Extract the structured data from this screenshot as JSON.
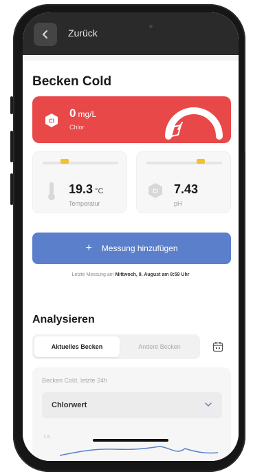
{
  "topbar": {
    "back_label": "Zurück"
  },
  "pool": {
    "title": "Becken Cold"
  },
  "chlor": {
    "value": "0",
    "unit": "mg/L",
    "label": "Chlor",
    "symbol": "Cl",
    "level_fraction": 0.0
  },
  "temperature": {
    "value": "19.3",
    "unit": "°C",
    "label": "Temperatur",
    "indicator_fraction": 0.27
  },
  "ph": {
    "value": "7.43",
    "unit": "",
    "label": "pH",
    "symbol": "Cl",
    "indicator_fraction": 0.74
  },
  "add_measurement": {
    "label": "Messung hinzufügen",
    "icon": "plus-icon"
  },
  "last_measurement": {
    "prefix": "Letzte Messung am",
    "date": "Mittwoch, 9. August am 8:59 Uhr"
  },
  "analysis": {
    "title": "Analysieren",
    "tabs": [
      {
        "label": "Aktuelles Becken",
        "active": true
      },
      {
        "label": "Andere Becken",
        "active": false
      }
    ],
    "calendar_icon": "calendar-icon",
    "subtitle": "Becken Cold, letzte 24h",
    "metric_select": "Chlorwert",
    "y_tick": "1.5"
  },
  "colors": {
    "danger": "#e84848",
    "primary": "#5b7fcb",
    "indicator": "#f2c132",
    "line": "#5b7fcb"
  }
}
